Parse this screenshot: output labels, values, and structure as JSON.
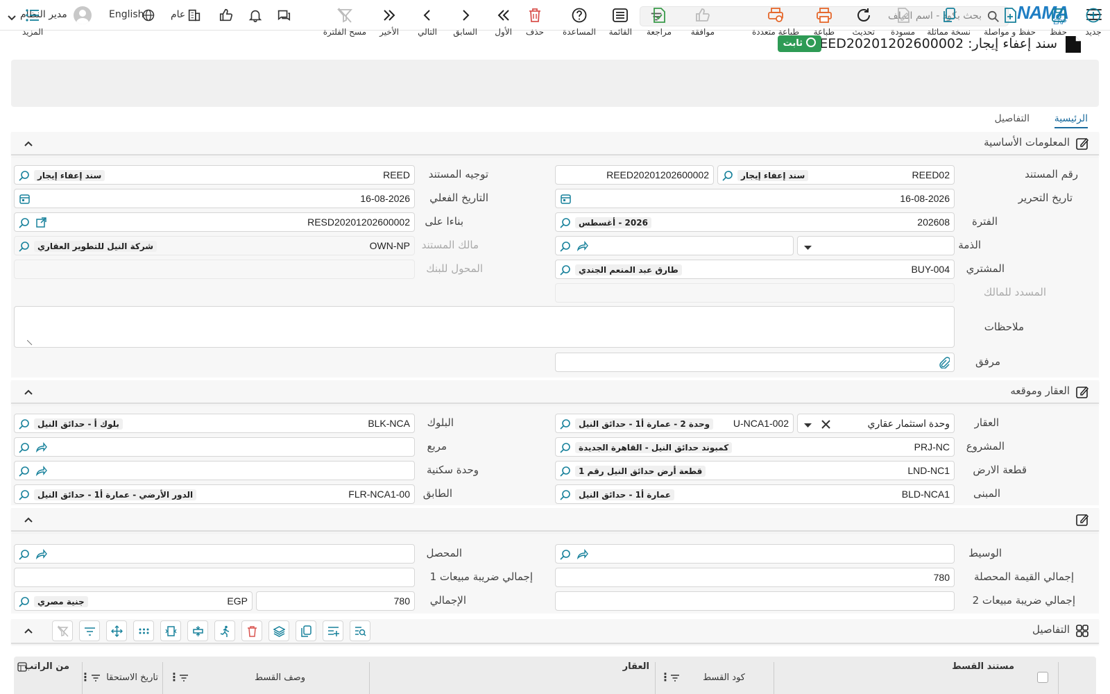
{
  "topbar": {
    "search_placeholder": "بحث بكود - اسم الملف",
    "logo_text": "NAMA",
    "logo_sub": "ERP",
    "company_label": "عام",
    "language_label": "English",
    "user_label": "مدير النظام"
  },
  "page": {
    "title": "سند إعفاء إيجار: REED20201202600002",
    "status": "ثابت"
  },
  "toolbar": {
    "new": "جديد",
    "save": "حفظ",
    "save_continue": "حفظ و مواصلة",
    "duplicate": "نسخة مماثلة",
    "draft": "مسودة",
    "refresh": "تحديث",
    "print": "طباعة",
    "multi_print": "طباعة متعددة",
    "approve": "موافقة",
    "review": "مراجعة",
    "list": "القائمة",
    "help": "المساعدة",
    "delete": "حذف",
    "first": "الأول",
    "previous": "السابق",
    "next": "التالي",
    "last": "الأخير",
    "clear_filter": "مسح الفلترة",
    "more": "المزيد"
  },
  "tabs": {
    "main": "الرئيسية",
    "details": "التفاصيل"
  },
  "basic": {
    "title": "المعلومات الأساسية",
    "doc_number_label": "رقم المستند",
    "doc_number_book": "REED02",
    "doc_number_book_desc": "سند إعفاء إيجار",
    "doc_number_code": "REED20201202600002",
    "doc_direction_label": "توجيه المستند",
    "doc_direction_value": "REED",
    "doc_direction_desc": "سند إعفاء إيجار",
    "edit_date_label": "تاريخ التحرير",
    "edit_date_value": "16-08-2026",
    "actual_date_label": "التاريخ الفعلي",
    "actual_date_value": "16-08-2026",
    "period_label": "الفترة",
    "period_value": "202608",
    "period_desc": "2026 - أغسطس",
    "based_on_label": "بناءا على",
    "based_on_value": "RESD20201202600002",
    "liability_label": "الذمة",
    "doc_owner_label": "مالك المستند",
    "doc_owner_value": "OWN-NP",
    "doc_owner_desc": "شركة النيل للتطوير العقاري",
    "buyer_label": "المشتري",
    "buyer_value": "BUY-004",
    "buyer_desc": "طارق عبد المنعم الجندي",
    "bank_transfer_label": "المحول للبنك",
    "paid_owner_label": "المسدد للمالك",
    "notes_label": "ملاحظات",
    "attachment_label": "مرفق"
  },
  "property": {
    "title": "العقار وموقعه",
    "property_label": "العقار",
    "property_type": "وحدة استثمار عقاري",
    "property_code": "U-NCA1-002",
    "property_desc": "وحدة 2 - عمارة أ1 - حدائق النيل",
    "block_label": "البلوك",
    "block_value": "BLK-NCA",
    "block_desc": "بلوك أ - حدائق النيل",
    "project_label": "المشروع",
    "project_value": "PRJ-NC",
    "project_desc": "كمبوند حدائق النيل - القاهرة الجديدة",
    "square_label": "مربع",
    "land_label": "قطعة الارض",
    "land_value": "LND-NC1",
    "land_desc": "قطعة أرض حدائق النيل رقم 1",
    "residential_label": "وحدة سكنية",
    "building_label": "المبنى",
    "building_value": "BLD-NCA1",
    "building_desc": "عمارة أ1 - حدائق النيل",
    "floor_label": "الطابق",
    "floor_value": "FLR-NCA1-00",
    "floor_desc": "الدور الأرضي - عمارة أ1 - حدائق النيل"
  },
  "totals": {
    "broker_label": "الوسيط",
    "collector_label": "المحصل",
    "total_collected_label": "إجمالي القيمة المحصلة",
    "total_collected_value": "780",
    "sales_tax1_label": "إجمالي ضريبة مبيعات 1",
    "sales_tax2_label": "إجمالي ضريبة مبيعات 2",
    "grand_total_label": "الإجمالي",
    "grand_total_value": "780",
    "currency_code": "EGP",
    "currency_desc": "جنية مصري"
  },
  "details": {
    "title": "التفاصيل",
    "col_installment_doc": "مستند القسط",
    "col_installment_code": "كود القسط",
    "col_property": "العقار",
    "col_installment_desc": "وصف القسط",
    "col_due_date": "تاريخ الاستحقا",
    "col_from_salary": "من الراتب"
  },
  "colors": {
    "accent": "#1a6b9e",
    "icon_teal": "#17819b",
    "status_green": "#2e9b55",
    "danger": "#d9534f",
    "print_orange": "#e5672a",
    "approve_green": "#3a9a4a"
  }
}
